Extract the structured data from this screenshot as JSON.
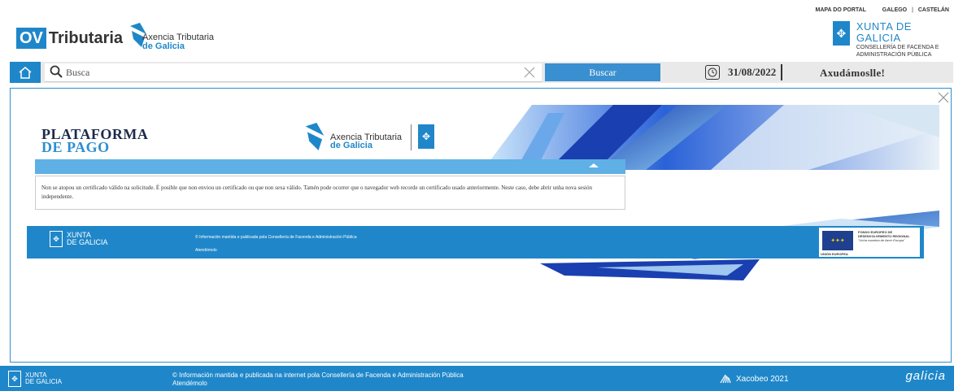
{
  "header": {
    "logo_ov": "OV",
    "logo_tributaria": "Tributaria",
    "agency_line1": "Axencia Tributaria",
    "agency_line2": "de Galicia",
    "top_links": [
      "MAPA DO PORTAL",
      "GALEGO",
      "CASTELÁN"
    ],
    "top_sep": "|",
    "xunta_title": "XUNTA DE GALICIA",
    "xunta_sub1": "CONSELLERÍA DE FACENDA E",
    "xunta_sub2": "ADMINISTRACIÓN PÚBLICA"
  },
  "searchbar": {
    "placeholder": "Busca",
    "button_label": "Buscar",
    "date": "31/08/2022",
    "help_label": "Axudámoslle!"
  },
  "frame": {
    "title_line1": "PLATAFORMA",
    "title_line2": "DE PAGO",
    "agency_line1": "Axencia Tributaria",
    "agency_line2": "de Galicia",
    "message": "Non se atopou un certificado válido na solicitude. É posible que non enviou un certificado ou que non sexa válido. Tamén pode ocorrer que o navegador web recorde un certificado usado anteriormente. Neste caso, debe abrir unha nova sesión independente.",
    "footer_xunta_line1": "XUNTA",
    "footer_xunta_line2": "DE GALICIA",
    "footer_info": "© Información mantida e publicada pola Consellería de Facenda e Administración Pública",
    "footer_link": "Atendémolo",
    "eu_text": "FONDO EUROPEO DE DESENVOLVEMENTO REGIONAL",
    "eu_motto": "\"Unha maneira de facer Europa\"",
    "eu_label": "UNIÓN EUROPEA"
  },
  "footer": {
    "xunta_line1": "XUNTA",
    "xunta_line2": "DE GALICIA",
    "info": "© Información mantida e publicada na internet pola Consellería de Facenda e Administración Pública",
    "link": "Atendémolo",
    "xacobeo": "Xacobeo 2021",
    "galicia": "galicia"
  },
  "colors": {
    "brand_blue": "#1f87c9",
    "button_blue": "#3a8fd0",
    "bar_blue": "#5fb0e4"
  }
}
